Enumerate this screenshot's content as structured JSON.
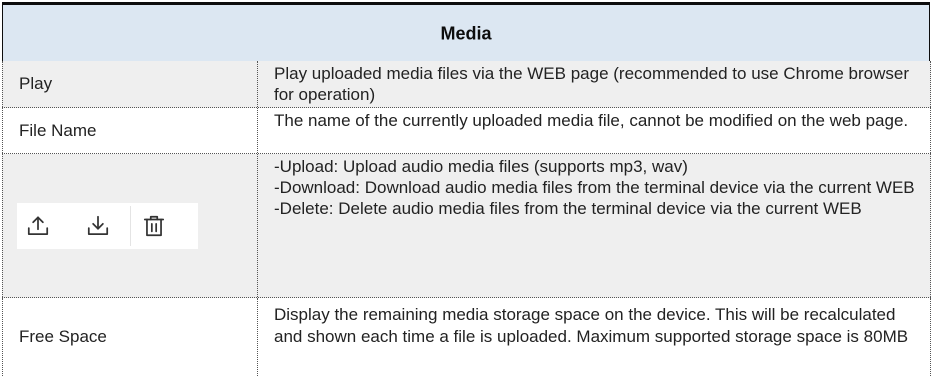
{
  "header": {
    "title": "Media"
  },
  "rows": [
    {
      "label": "Play",
      "desc": [
        "Play uploaded media files via the WEB page (recommended to use Chrome browser for operation)"
      ]
    },
    {
      "label": "File Name",
      "desc": [
        "The name of the currently uploaded media file, cannot be modified on the web page."
      ]
    },
    {
      "icons": [
        "upload-icon",
        "download-icon",
        "trash-icon"
      ],
      "desc": [
        "-Upload: Upload audio media files (supports mp3, wav)",
        "-Download: Download audio media files from the terminal device via the current WEB",
        "-Delete: Delete audio media files from the terminal device via the current WEB"
      ]
    },
    {
      "label": "Free Space",
      "desc": [
        "Display the remaining media storage space on the device. This will be recalculated and shown each time a file is uploaded. Maximum supported storage space is 80MB"
      ]
    }
  ]
}
